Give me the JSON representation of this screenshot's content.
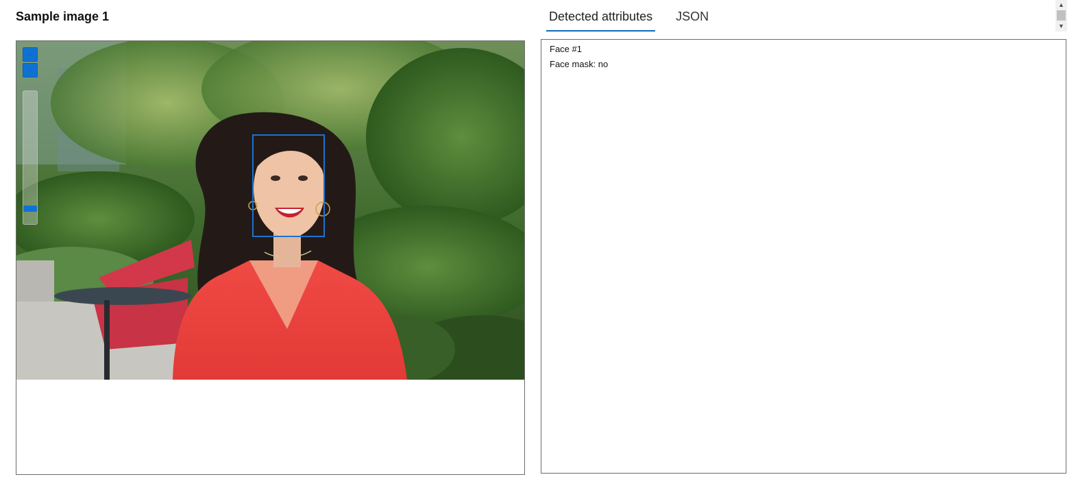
{
  "left_panel": {
    "title": "Sample image 1",
    "zoom_level": 0.1
  },
  "tabs": [
    {
      "label": "Detected attributes",
      "active": true
    },
    {
      "label": "JSON",
      "active": false
    }
  ],
  "result": {
    "face_label": "Face #1",
    "mask_line": "Face mask: no"
  },
  "controls": {
    "zoom_in_icon": "plus-icon",
    "zoom_out_icon": "minus-icon",
    "scroll_up_icon": "chevron-up-icon",
    "scroll_down_icon": "chevron-down-icon"
  },
  "colors": {
    "accent": "#0f6cbd",
    "face_box": "#1a73d0",
    "panel_border": "#6b6b6b"
  }
}
